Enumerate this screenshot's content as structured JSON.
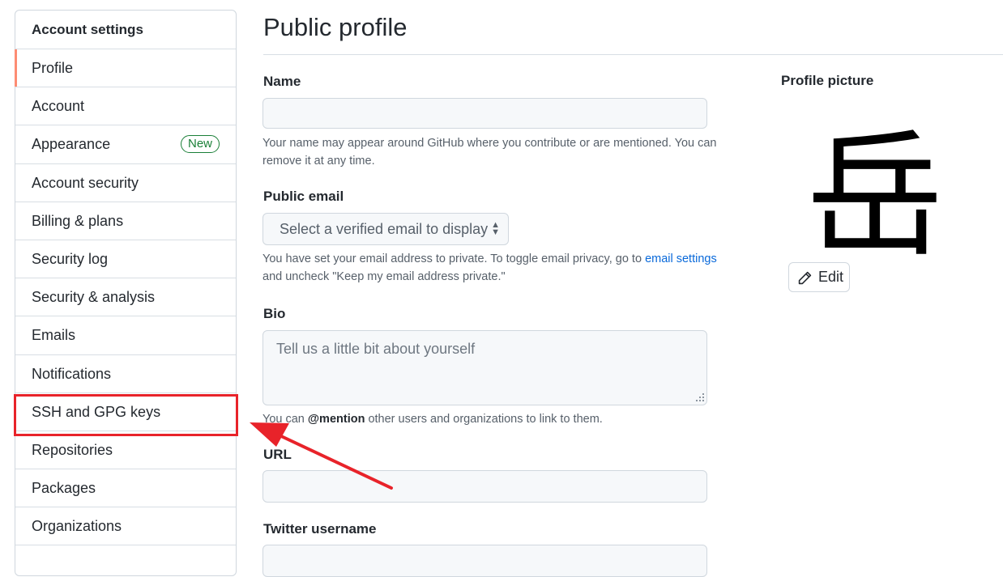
{
  "sidebar": {
    "header": "Account settings",
    "items": [
      {
        "label": "Profile",
        "selected": true
      },
      {
        "label": "Account"
      },
      {
        "label": "Appearance",
        "badge": "New"
      },
      {
        "label": "Account security"
      },
      {
        "label": "Billing & plans"
      },
      {
        "label": "Security log"
      },
      {
        "label": "Security & analysis"
      },
      {
        "label": "Emails"
      },
      {
        "label": "Notifications"
      },
      {
        "label": "SSH and GPG keys"
      },
      {
        "label": "Repositories"
      },
      {
        "label": "Packages"
      },
      {
        "label": "Organizations"
      }
    ]
  },
  "main": {
    "title": "Public profile",
    "name": {
      "label": "Name",
      "value": "",
      "note": "Your name may appear around GitHub where you contribute or are mentioned. You can remove it at any time."
    },
    "public_email": {
      "label": "Public email",
      "selected": "Select a verified email to display",
      "note_before": "You have set your email address to private. To toggle email privacy, go to ",
      "note_link": "email settings",
      "note_after": " and uncheck \"Keep my email address private.\""
    },
    "bio": {
      "label": "Bio",
      "placeholder": "Tell us a little bit about yourself",
      "note_before": "You can ",
      "note_bold": "@mention",
      "note_after": " other users and organizations to link to them."
    },
    "url": {
      "label": "URL",
      "value": ""
    },
    "twitter": {
      "label": "Twitter username",
      "value": ""
    }
  },
  "profile_picture": {
    "label": "Profile picture",
    "glyph": "岳",
    "edit_label": "Edit",
    "edit_icon": "pencil-icon"
  },
  "annotation": {
    "target": "SSH and GPG keys",
    "color": "#e8232a"
  },
  "colors": {
    "selected_accent": "#fd8c73",
    "badge": "#1a7f37",
    "link": "#0969da"
  }
}
